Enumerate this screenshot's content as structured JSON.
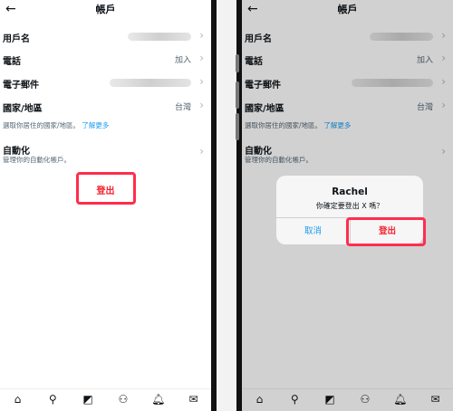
{
  "screen": {
    "title": "帳戶",
    "rows": [
      {
        "label": "用戶名",
        "value": ""
      },
      {
        "label": "電話",
        "value": "加入"
      },
      {
        "label": "電子郵件",
        "value": ""
      },
      {
        "label": "國家/地區",
        "value": "台灣"
      }
    ],
    "country_hint": "選取你居住的國家/地區。",
    "country_hint_link": "了解更多",
    "automation_label": "自動化",
    "automation_sub": "管理你的自動化帳戶。",
    "logout_label": "登出"
  },
  "dialog": {
    "title": "Rachel",
    "message": "你確定要登出 X 嗎？",
    "cancel_label": "取消",
    "confirm_label": "登出"
  },
  "icons": {
    "back": "back-arrow-icon",
    "chevron": "chevron-right-icon",
    "tabs": [
      "home-icon",
      "search-icon",
      "grok-icon",
      "communities-icon",
      "notifications-icon",
      "messages-icon"
    ]
  },
  "colors": {
    "danger": "#f4212e",
    "link": "#1d9bf0",
    "highlight": "#ff2d4d"
  }
}
